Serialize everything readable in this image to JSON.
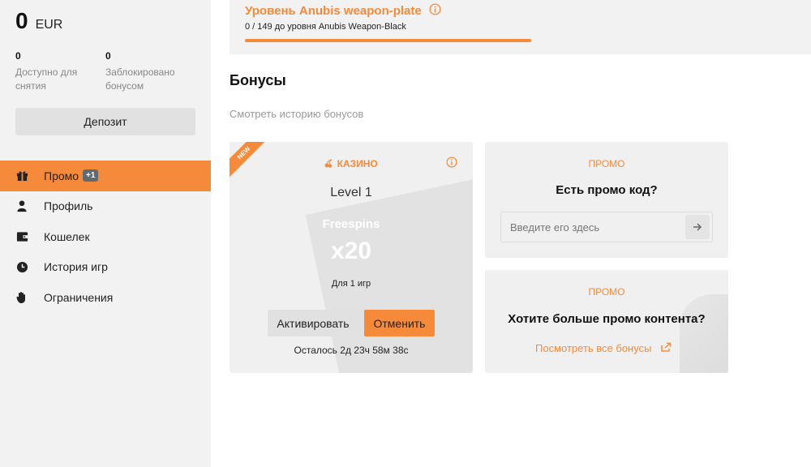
{
  "balance": {
    "amount": "0",
    "currency": "EUR",
    "withdrawable": {
      "value": "0",
      "label": "Доступно для снятия"
    },
    "locked": {
      "value": "0",
      "label": "Заблокировано бонусом"
    },
    "deposit_label": "Депозит"
  },
  "nav": {
    "items": [
      {
        "label": "Промо",
        "icon": "gift-icon",
        "badge": "+1",
        "active": true
      },
      {
        "label": "Профиль",
        "icon": "user-icon"
      },
      {
        "label": "Кошелек",
        "icon": "wallet-icon"
      },
      {
        "label": "История игр",
        "icon": "clock-icon"
      },
      {
        "label": "Ограничения",
        "icon": "hand-icon"
      }
    ]
  },
  "level": {
    "title": "Уровень Anubis weapon-plate",
    "progress_text": "0 / 149 до уровня Anubis Weapon-Black",
    "progress": 0
  },
  "bonuses": {
    "title": "Бонусы",
    "history_link": "Смотреть историю бонусов",
    "card": {
      "ribbon": "NEW",
      "category": "КАЗИНО",
      "level": "Level 1",
      "type": "Freespins",
      "multiplier": "x20",
      "for_games": "Для 1 игр",
      "activate_label": "Активировать",
      "cancel_label": "Отменить",
      "remaining": "Осталось 2д 23ч 58м 38с"
    }
  },
  "promo_code": {
    "label": "ПРОМО",
    "question": "Есть промо код?",
    "placeholder": "Введите его здесь"
  },
  "promo_more": {
    "label": "ПРОМО",
    "question": "Хотите больше промо контента?",
    "link": "Посмотреть все бонусы"
  },
  "colors": {
    "accent": "#f58a3a",
    "sidebar_bg": "#f2f2f2",
    "card_bg": "#f0f0f0"
  }
}
